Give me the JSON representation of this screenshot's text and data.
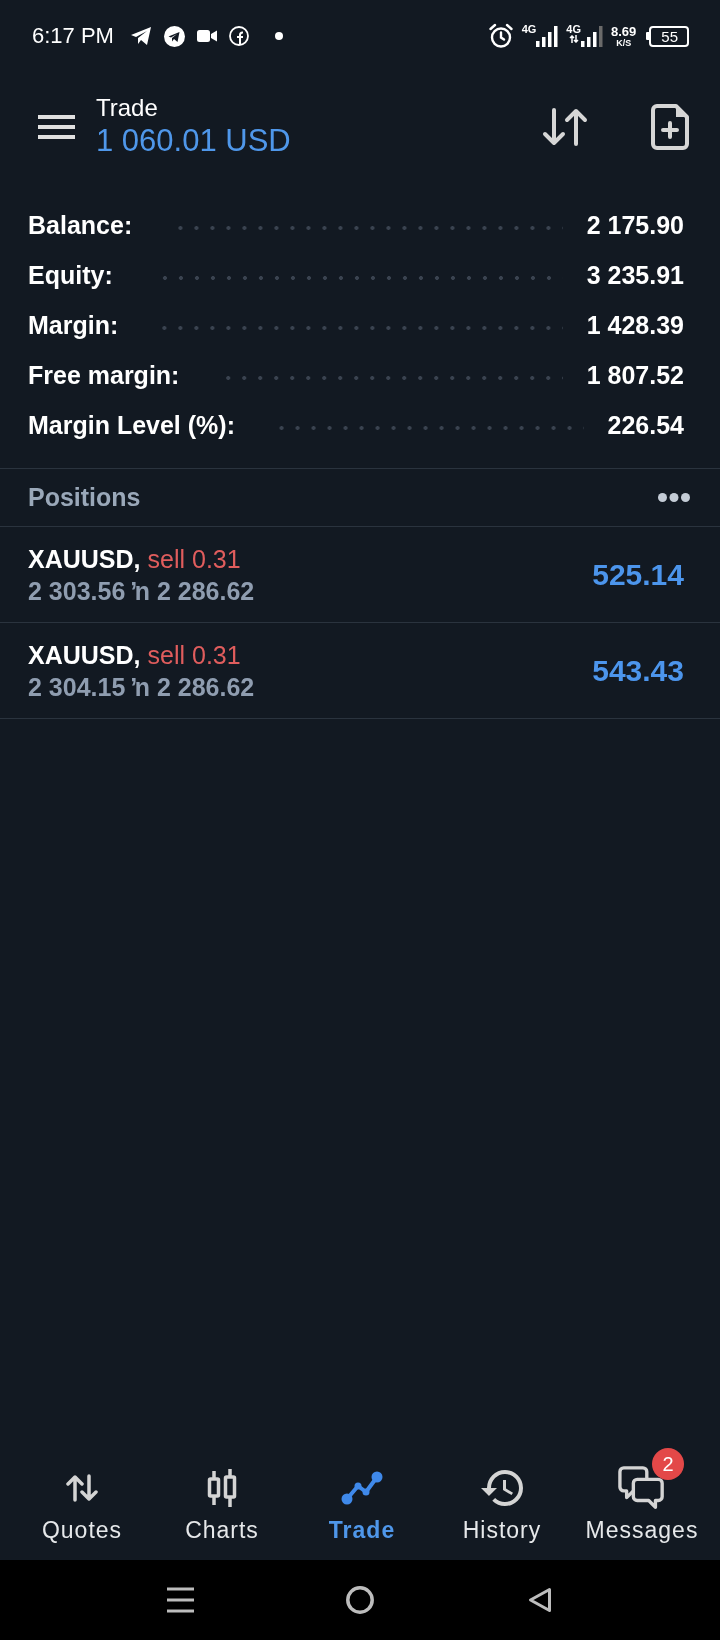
{
  "status_bar": {
    "time": "6:17 PM",
    "networks": [
      {
        "label": "4G",
        "kind": "plain"
      },
      {
        "label": "4G",
        "kind": "data"
      }
    ],
    "speed": "8.69",
    "speed_unit": "K/S",
    "battery": "55"
  },
  "header": {
    "title": "Trade",
    "amount": "1 060.01 USD"
  },
  "account": [
    {
      "label": "Balance:",
      "value": "2 175.90"
    },
    {
      "label": "Equity:",
      "value": "3 235.91"
    },
    {
      "label": "Margin:",
      "value": "1 428.39"
    },
    {
      "label": "Free margin:",
      "value": "1 807.52"
    },
    {
      "label": "Margin Level (%):",
      "value": "226.54"
    }
  ],
  "positions": {
    "title": "Positions",
    "items": [
      {
        "symbol": "XAUUSD,",
        "order": "sell 0.31",
        "prices": "2 303.56 ŉ 2 286.62",
        "profit": "525.14"
      },
      {
        "symbol": "XAUUSD,",
        "order": "sell 0.31",
        "prices": "2 304.15 ŉ 2 286.62",
        "profit": "543.43"
      }
    ]
  },
  "bottom_nav": {
    "tabs": [
      {
        "label": "Quotes",
        "selected": false
      },
      {
        "label": "Charts",
        "selected": false
      },
      {
        "label": "Trade",
        "selected": true
      },
      {
        "label": "History",
        "selected": false
      },
      {
        "label": "Messages",
        "selected": false,
        "badge": "2"
      }
    ]
  }
}
